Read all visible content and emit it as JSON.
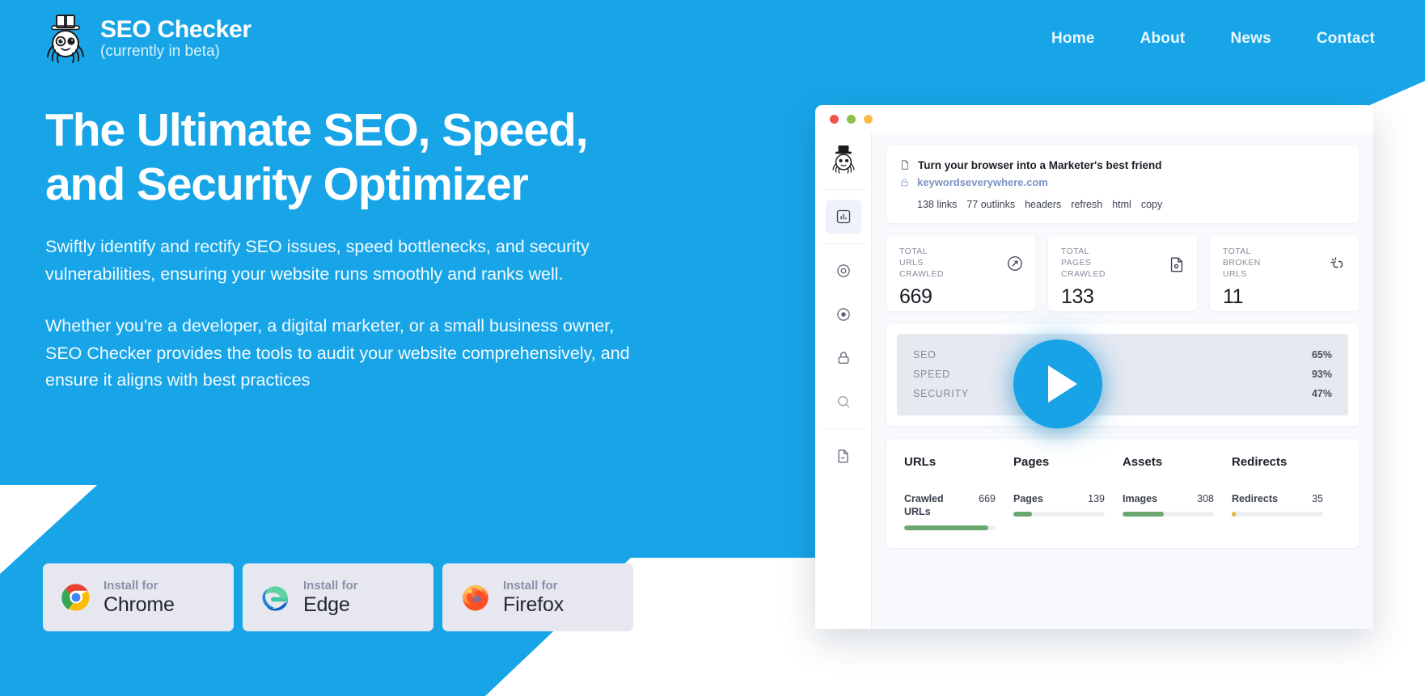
{
  "brand": {
    "name": "SEO Checker",
    "subtitle": "(currently in beta)",
    "logo_icon": "spider-tophat-icon"
  },
  "nav": {
    "items": [
      {
        "label": "Home"
      },
      {
        "label": "About"
      },
      {
        "label": "News"
      },
      {
        "label": "Contact"
      }
    ]
  },
  "hero": {
    "title_line1": "The Ultimate SEO, Speed,",
    "title_line2": "and Security Optimizer",
    "paragraph1": "Swiftly identify and rectify SEO issues, speed bottlenecks, and security vulnerabilities, ensuring your website runs smoothly and ranks well.",
    "paragraph2": "Whether you're a developer, a digital marketer, or a small business owner, SEO Checker provides the tools to audit your website comprehensively, and ensure it aligns with best practices"
  },
  "install": {
    "prefix": "Install for",
    "buttons": [
      {
        "browser": "Chrome",
        "icon": "chrome-icon"
      },
      {
        "browser": "Edge",
        "icon": "edge-icon"
      },
      {
        "browser": "Firefox",
        "icon": "firefox-icon"
      }
    ]
  },
  "mockup": {
    "window_dots": [
      "red",
      "green",
      "yellow"
    ],
    "sidebar": {
      "logo_icon": "spider-tophat-icon",
      "items": [
        {
          "icon": "bar-chart-icon",
          "active": true
        },
        {
          "icon": "gauge-icon",
          "active": false
        },
        {
          "icon": "target-icon",
          "active": false
        },
        {
          "icon": "lock-icon",
          "active": false
        },
        {
          "icon": "search-icon",
          "active": false
        },
        {
          "icon": "document-icon",
          "active": false
        }
      ]
    },
    "page_card": {
      "title": "Turn your browser into a Marketer's best friend",
      "title_icon": "page-icon",
      "url": "keywordseverywhere.com",
      "url_icon": "lock-icon",
      "meta": [
        "138 links",
        "77 outlinks",
        "headers",
        "refresh",
        "html",
        "copy"
      ]
    },
    "stats": [
      {
        "label": "TOTAL\nURLS\nCRAWLED",
        "value": "669",
        "icon": "link-icon"
      },
      {
        "label": "TOTAL\nPAGES\nCRAWLED",
        "value": "133",
        "icon": "file-icon"
      },
      {
        "label": "TOTAL\nBROKEN\nURLS",
        "value": "11",
        "icon": "broken-link-icon"
      }
    ],
    "scores": [
      {
        "name": "SEO",
        "value": "65%"
      },
      {
        "name": "SPEED",
        "value": "93%"
      },
      {
        "name": "SECURITY",
        "value": "47%"
      }
    ],
    "breakdown": {
      "headers": [
        "URLs",
        "Pages",
        "Assets",
        "Redirects"
      ],
      "items": [
        {
          "name": "Crawled URLs",
          "value": "669",
          "pct": 92,
          "color": "#6aa86f"
        },
        {
          "name": "Pages",
          "value": "139",
          "pct": 20,
          "color": "#6aa86f"
        },
        {
          "name": "Images",
          "value": "308",
          "pct": 45,
          "color": "#6aa86f"
        },
        {
          "name": "Redirects",
          "value": "35",
          "pct": 4,
          "color": "#e4b53c"
        }
      ]
    },
    "play_button_icon": "play-icon"
  },
  "colors": {
    "brand_blue": "#18a5e8",
    "play_blue": "#17a3e6",
    "button_grey": "#e6e7ef",
    "bar_green": "#6aa86f",
    "bar_yellow": "#e4b53c"
  }
}
